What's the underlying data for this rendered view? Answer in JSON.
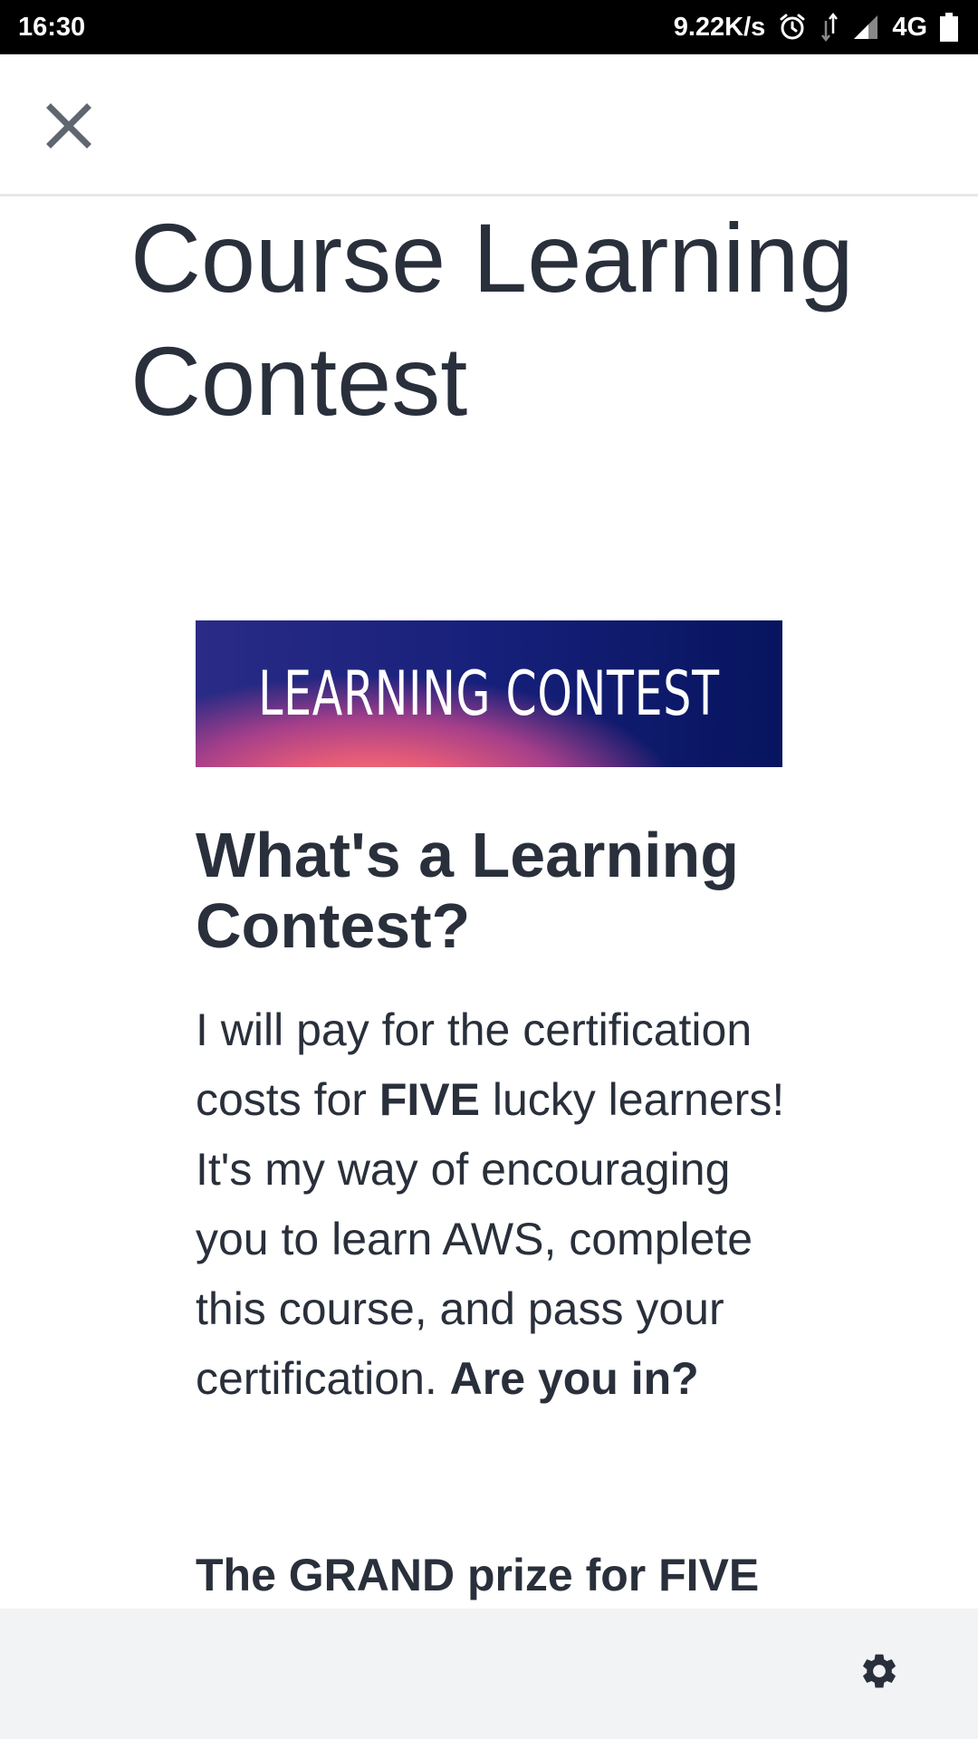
{
  "status_bar": {
    "time": "16:30",
    "network_speed": "9.22K/s",
    "network_type": "4G",
    "icons": [
      "alarm-icon",
      "data-transfer-icon",
      "signal-icon",
      "battery-icon"
    ]
  },
  "top_bar": {
    "close_icon": "close-icon"
  },
  "page": {
    "title": "Course Learning Contest"
  },
  "banner": {
    "text": "LEARNING CONTEST"
  },
  "section": {
    "heading": "What's a Learning Contest?",
    "paragraph": {
      "part1": "I will pay for the certification costs for ",
      "bold1": "FIVE",
      "part2": " lucky learners! It's my way of encouraging you to learn AWS, complete this course, and pass your certification. ",
      "bold2": "Are you in?"
    },
    "grand_prize_heading": "The GRAND prize for FIVE"
  },
  "bottom_bar": {
    "settings_icon": "gear-icon"
  },
  "colors": {
    "text": "#29303b",
    "status_bar_bg": "#000000",
    "bottom_bar_bg": "#f2f3f5",
    "icon_gray": "#5f6670"
  }
}
